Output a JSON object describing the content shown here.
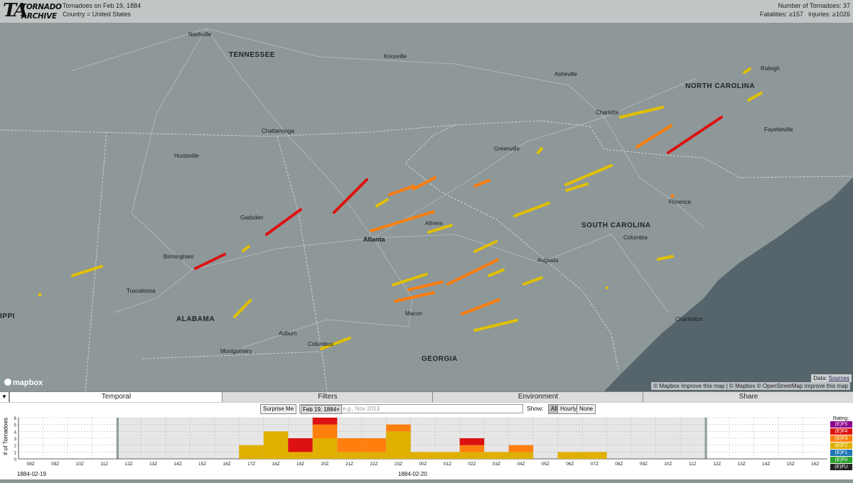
{
  "header": {
    "logo_ta": "TA",
    "logo_word1": "TORNADO",
    "logo_word2": "ARCHIVE",
    "title": "Tornadoes on Feb 19, 1884",
    "country": "Country = United States",
    "count_label": "Number of Tornadoes: 37",
    "fatalities": "Fatalities: ≥157",
    "injuries": "Injuries: ≥1026"
  },
  "map": {
    "states": [
      "TENNESSEE",
      "NORTH CAROLINA",
      "SOUTH CAROLINA",
      "ALABAMA",
      "GEORGIA",
      "IPPI"
    ],
    "cities": [
      "Nashville",
      "Atlanta",
      "Birmingham",
      "Charlotte",
      "Augusta",
      "Columbia",
      "Macon",
      "Montgomery",
      "Charleston",
      "Raleigh",
      "Fayetteville",
      "Florence",
      "Tuscaloosa",
      "Greenville",
      "Chattanooga",
      "Huntsville",
      "Athens",
      "Auburn",
      "Columbus",
      "Gadsden",
      "Asheville",
      "Knoxville"
    ],
    "attribution": "© Mapbox Improve this map | © Mapbox © OpenStreetMap Improve this map",
    "data_label": "Data:",
    "data_link": "Sources",
    "mapbox_label": "mapbox"
  },
  "tabs": {
    "toggle": "▼",
    "items": [
      "Temporal",
      "Filters",
      "Environment",
      "Share"
    ]
  },
  "controls": {
    "surprise": "Surprise Me",
    "date_chip": "Feb 19, 1884×",
    "placeholder": "e.g., Nov 2013",
    "show_label": "Show:",
    "show_options": [
      "All",
      "Hourly",
      "None"
    ]
  },
  "chart_data": {
    "type": "bar",
    "ylabel": "# of Tornadoes",
    "ylim": [
      0,
      6
    ],
    "yticks": [
      0,
      1,
      2,
      3,
      4,
      5,
      6
    ],
    "xticks": [
      "08Z",
      "09Z",
      "10Z",
      "11Z",
      "12Z",
      "13Z",
      "14Z",
      "15Z",
      "16Z",
      "17Z",
      "18Z",
      "19Z",
      "20Z",
      "21Z",
      "22Z",
      "23Z",
      "00Z",
      "01Z",
      "02Z",
      "03Z",
      "04Z",
      "05Z",
      "06Z",
      "07Z",
      "08Z",
      "09Z",
      "10Z",
      "11Z",
      "12Z",
      "13Z",
      "14Z",
      "15Z",
      "16Z"
    ],
    "date_labels": [
      "1884-02-19",
      "1884-02-20"
    ],
    "categories": [
      "17Z",
      "18Z",
      "19Z",
      "20Z",
      "21Z",
      "22Z",
      "23Z",
      "00Z",
      "01Z",
      "02Z",
      "03Z",
      "04Z",
      "05Z",
      "06Z",
      "07Z"
    ],
    "series": [
      {
        "name": "(E)F1",
        "values": [
          0,
          0,
          0,
          0,
          0,
          0,
          0,
          0,
          0,
          0,
          0,
          0,
          0,
          0,
          0
        ]
      },
      {
        "name": "(E)F2",
        "values": [
          2,
          4,
          1,
          3,
          1,
          1,
          4,
          1,
          1,
          1,
          1,
          1,
          0,
          1,
          1
        ]
      },
      {
        "name": "(E)F3",
        "values": [
          0,
          0,
          0,
          2,
          2,
          2,
          1,
          0,
          0,
          1,
          0,
          1,
          0,
          0,
          0
        ]
      },
      {
        "name": "(E)F4",
        "values": [
          0,
          0,
          2,
          1,
          0,
          0,
          0,
          0,
          0,
          1,
          0,
          0,
          0,
          0,
          0
        ]
      }
    ],
    "legend": {
      "title": "Rating:",
      "items": [
        {
          "label": "(E)F5",
          "color": "#8b008b"
        },
        {
          "label": "(E)F4",
          "color": "#dd1111"
        },
        {
          "label": "(E)F3",
          "color": "#ff7f0e"
        },
        {
          "label": "(E)F2",
          "color": "#e0b000"
        },
        {
          "label": "(E)F1",
          "color": "#1f77b4"
        },
        {
          "label": "(E)F0",
          "color": "#2ca02c"
        },
        {
          "label": "(E)FU",
          "color": "#222222"
        }
      ]
    }
  }
}
